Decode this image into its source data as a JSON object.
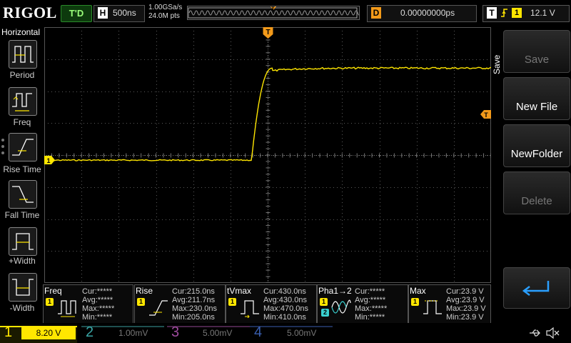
{
  "top": {
    "logo": "RIGOL",
    "trigger_status": "T'D",
    "horizontal_letter": "H",
    "timebase": "500ns",
    "sample_rate": "1.00GSa/s",
    "memory_depth": "24.0M pts",
    "delay_letter": "D",
    "delay": "0.00000000ps",
    "trigger_letter": "T",
    "trigger_edge": "rising-edge-icon",
    "trigger_source": "1",
    "trigger_level": "12.1 V"
  },
  "left_panel": {
    "title": "Horizontal",
    "items": [
      {
        "label": "Period",
        "icon": "period-icon"
      },
      {
        "label": "Freq",
        "icon": "frequency-icon"
      },
      {
        "label": "Rise Time",
        "icon": "rise-time-icon"
      },
      {
        "label": "Fall Time",
        "icon": "fall-time-icon"
      },
      {
        "label": "+Width",
        "icon": "positive-width-icon"
      },
      {
        "label": "-Width",
        "icon": "negative-width-icon"
      }
    ]
  },
  "right_menu": {
    "title": "Save",
    "buttons": [
      {
        "label": "Save",
        "enabled": false
      },
      {
        "label": "New File",
        "enabled": true
      },
      {
        "label": "NewFolder",
        "enabled": true
      },
      {
        "label": "Delete",
        "enabled": false
      }
    ],
    "return_icon": "return-arrow-icon"
  },
  "markers": {
    "trigger_position": "T",
    "trigger_level": "T",
    "channel1_ground": "1"
  },
  "waveform": {
    "channel": "1",
    "color": "#ffe600",
    "low_level_fraction": 0.52,
    "high_level_fraction": 0.16,
    "edge_start_fraction": 0.464,
    "edge_end_fraction": 0.51
  },
  "measurements": [
    {
      "name": "Freq",
      "source": "1",
      "icon": "frequency-icon",
      "cur": "Cur:*****",
      "avg": "Avg:*****",
      "max": "Max:*****",
      "min": "Min:*****"
    },
    {
      "name": "Rise",
      "source": "1",
      "icon": "rise-time-icon",
      "cur": "Cur:215.0ns",
      "avg": "Avg:211.7ns",
      "max": "Max:230.0ns",
      "min": "Min:205.0ns"
    },
    {
      "name": "tVmax",
      "source": "1",
      "icon": "tvmax-icon",
      "cur": "Cur:430.0ns",
      "avg": "Avg:430.0ns",
      "max": "Max:470.0ns",
      "min": "Min:410.0ns"
    },
    {
      "name": "Pha1→2",
      "source": "1",
      "source2": "2",
      "icon": "phase-icon",
      "cur": "Cur:*****",
      "avg": "Avg:*****",
      "max": "Max:*****",
      "min": "Min:*****"
    },
    {
      "name": "Max",
      "source": "1",
      "icon": "vmax-icon",
      "cur": "Cur:23.9 V",
      "avg": "Avg:23.9 V",
      "max": "Max:23.9 V",
      "min": "Min:23.9 V"
    }
  ],
  "channels": [
    {
      "num": "1",
      "value": "8.20 V",
      "active": true,
      "color": "#ffe600"
    },
    {
      "num": "2",
      "value": "1.00mV",
      "active": false,
      "color": "#3aa6a6"
    },
    {
      "num": "3",
      "value": "5.00mV",
      "active": false,
      "color": "#a04ca0"
    },
    {
      "num": "4",
      "value": "5.00mV",
      "active": false,
      "color": "#3a5fb0"
    }
  ],
  "status_icons": [
    "usb-icon",
    "speaker-muted-icon"
  ]
}
